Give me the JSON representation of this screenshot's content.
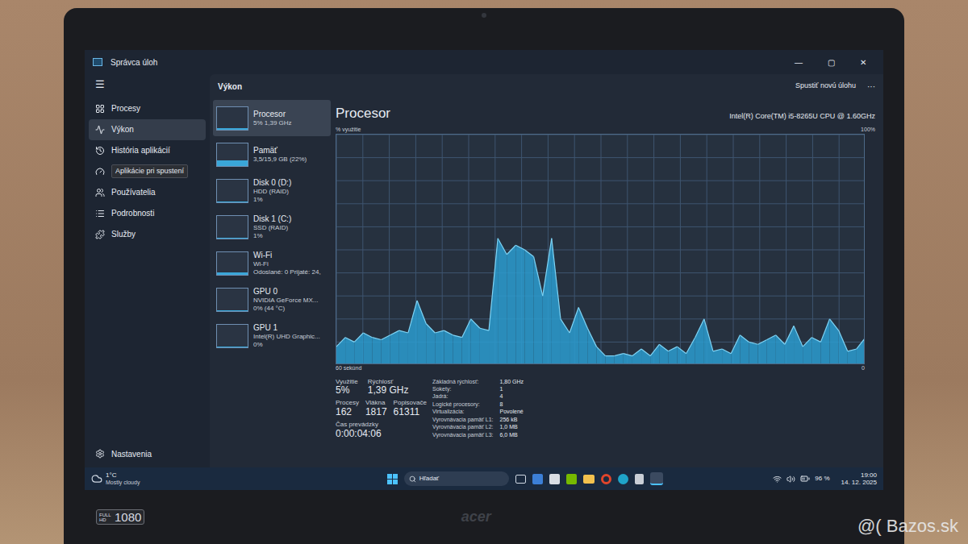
{
  "photo": {
    "sticker_top": "FULL HD",
    "sticker_res": "1080",
    "logo": "acer",
    "watermark": "@( Bazos.sk"
  },
  "window": {
    "title": "Správca úloh",
    "controls": [
      "—",
      "▢",
      "✕"
    ]
  },
  "sidebar": {
    "menu_icon": "☰",
    "items": [
      {
        "label": "Procesy",
        "selected": false,
        "hovered": false
      },
      {
        "label": "Výkon",
        "selected": true,
        "hovered": false
      },
      {
        "label": "História aplikácií",
        "selected": false,
        "hovered": false
      },
      {
        "label": "Aplikácie pri spustení",
        "selected": false,
        "hovered": true
      },
      {
        "label": "Používatelia",
        "selected": false,
        "hovered": false
      },
      {
        "label": "Podrobnosti",
        "selected": false,
        "hovered": false
      },
      {
        "label": "Služby",
        "selected": false,
        "hovered": false
      }
    ],
    "settings": "Nastavenia"
  },
  "header": {
    "title": "Výkon",
    "button": "Spustiť novú úlohu",
    "more": "···"
  },
  "devices": [
    {
      "name": "Procesor",
      "line1": "5% 1,39 GHz",
      "line2": "",
      "selected": true,
      "level": 0.05
    },
    {
      "name": "Pamäť",
      "line1": "3,5/15,9 GB (22%)",
      "line2": "",
      "selected": false,
      "level": 0.22
    },
    {
      "name": "Disk 0 (D:)",
      "line1": "HDD (RAID)",
      "line2": "1%",
      "selected": false,
      "level": 0.01
    },
    {
      "name": "Disk 1 (C:)",
      "line1": "SSD (RAID)",
      "line2": "1%",
      "selected": false,
      "level": 0.01
    },
    {
      "name": "Wi-Fi",
      "line1": "Wi-Fi",
      "line2": "Odoslané: 0 Prijaté: 24,",
      "selected": false,
      "level": 0.1
    },
    {
      "name": "GPU 0",
      "line1": "NVIDIA GeForce MX...",
      "line2": "0% (44 °C)",
      "selected": false,
      "level": 0
    },
    {
      "name": "GPU 1",
      "line1": "Intel(R) UHD Graphic...",
      "line2": "0%",
      "selected": false,
      "level": 0
    }
  ],
  "detail": {
    "title": "Procesor",
    "model": "Intel(R) Core(TM) i5-8265U CPU @ 1.60GHz"
  },
  "chart": {
    "y_label": "% využitie",
    "y_max": "100%",
    "x_start": "60 sekúnd",
    "x_end": "0",
    "values": [
      8,
      12,
      10,
      14,
      12,
      11,
      13,
      15,
      14,
      28,
      18,
      14,
      15,
      13,
      12,
      20,
      16,
      15,
      55,
      48,
      52,
      50,
      47,
      30,
      55,
      20,
      14,
      25,
      16,
      8,
      4,
      4,
      5,
      4,
      7,
      4,
      9,
      6,
      8,
      5,
      12,
      20,
      6,
      7,
      5,
      13,
      10,
      9,
      11,
      13,
      9,
      17,
      8,
      12,
      10,
      20,
      15,
      6,
      7,
      12
    ]
  },
  "usage": [
    {
      "label": "Využitie",
      "value": "5%"
    },
    {
      "label": "Rýchlosť",
      "value": "1,39 GHz"
    }
  ],
  "counts": [
    {
      "label": "Procesy",
      "value": "162"
    },
    {
      "label": "Vlákna",
      "value": "1817"
    },
    {
      "label": "Popisovače",
      "value": "61311"
    }
  ],
  "uptime": {
    "label": "Čas prevádzky",
    "value": "0:00:04:06"
  },
  "specs": [
    {
      "label": "Základná rýchlosť:",
      "value": "1,80 GHz"
    },
    {
      "label": "Sokety:",
      "value": "1"
    },
    {
      "label": "Jadrá:",
      "value": "4"
    },
    {
      "label": "Logické procesory:",
      "value": "8"
    },
    {
      "label": "Virtualizácia:",
      "value": "Povolené"
    },
    {
      "label": "Vyrovnávacia pamäť L1:",
      "value": "256 kB"
    },
    {
      "label": "Vyrovnávacia pamäť L2:",
      "value": "1,0 MB"
    },
    {
      "label": "Vyrovnávacia pamäť L3:",
      "value": "6,0 MB"
    }
  ],
  "taskbar": {
    "temp": "1°C",
    "weather": "Mostly cloudy",
    "search": "Hľadať",
    "battery": "96 %",
    "time": "19:00",
    "date": "14. 12. 2025"
  }
}
